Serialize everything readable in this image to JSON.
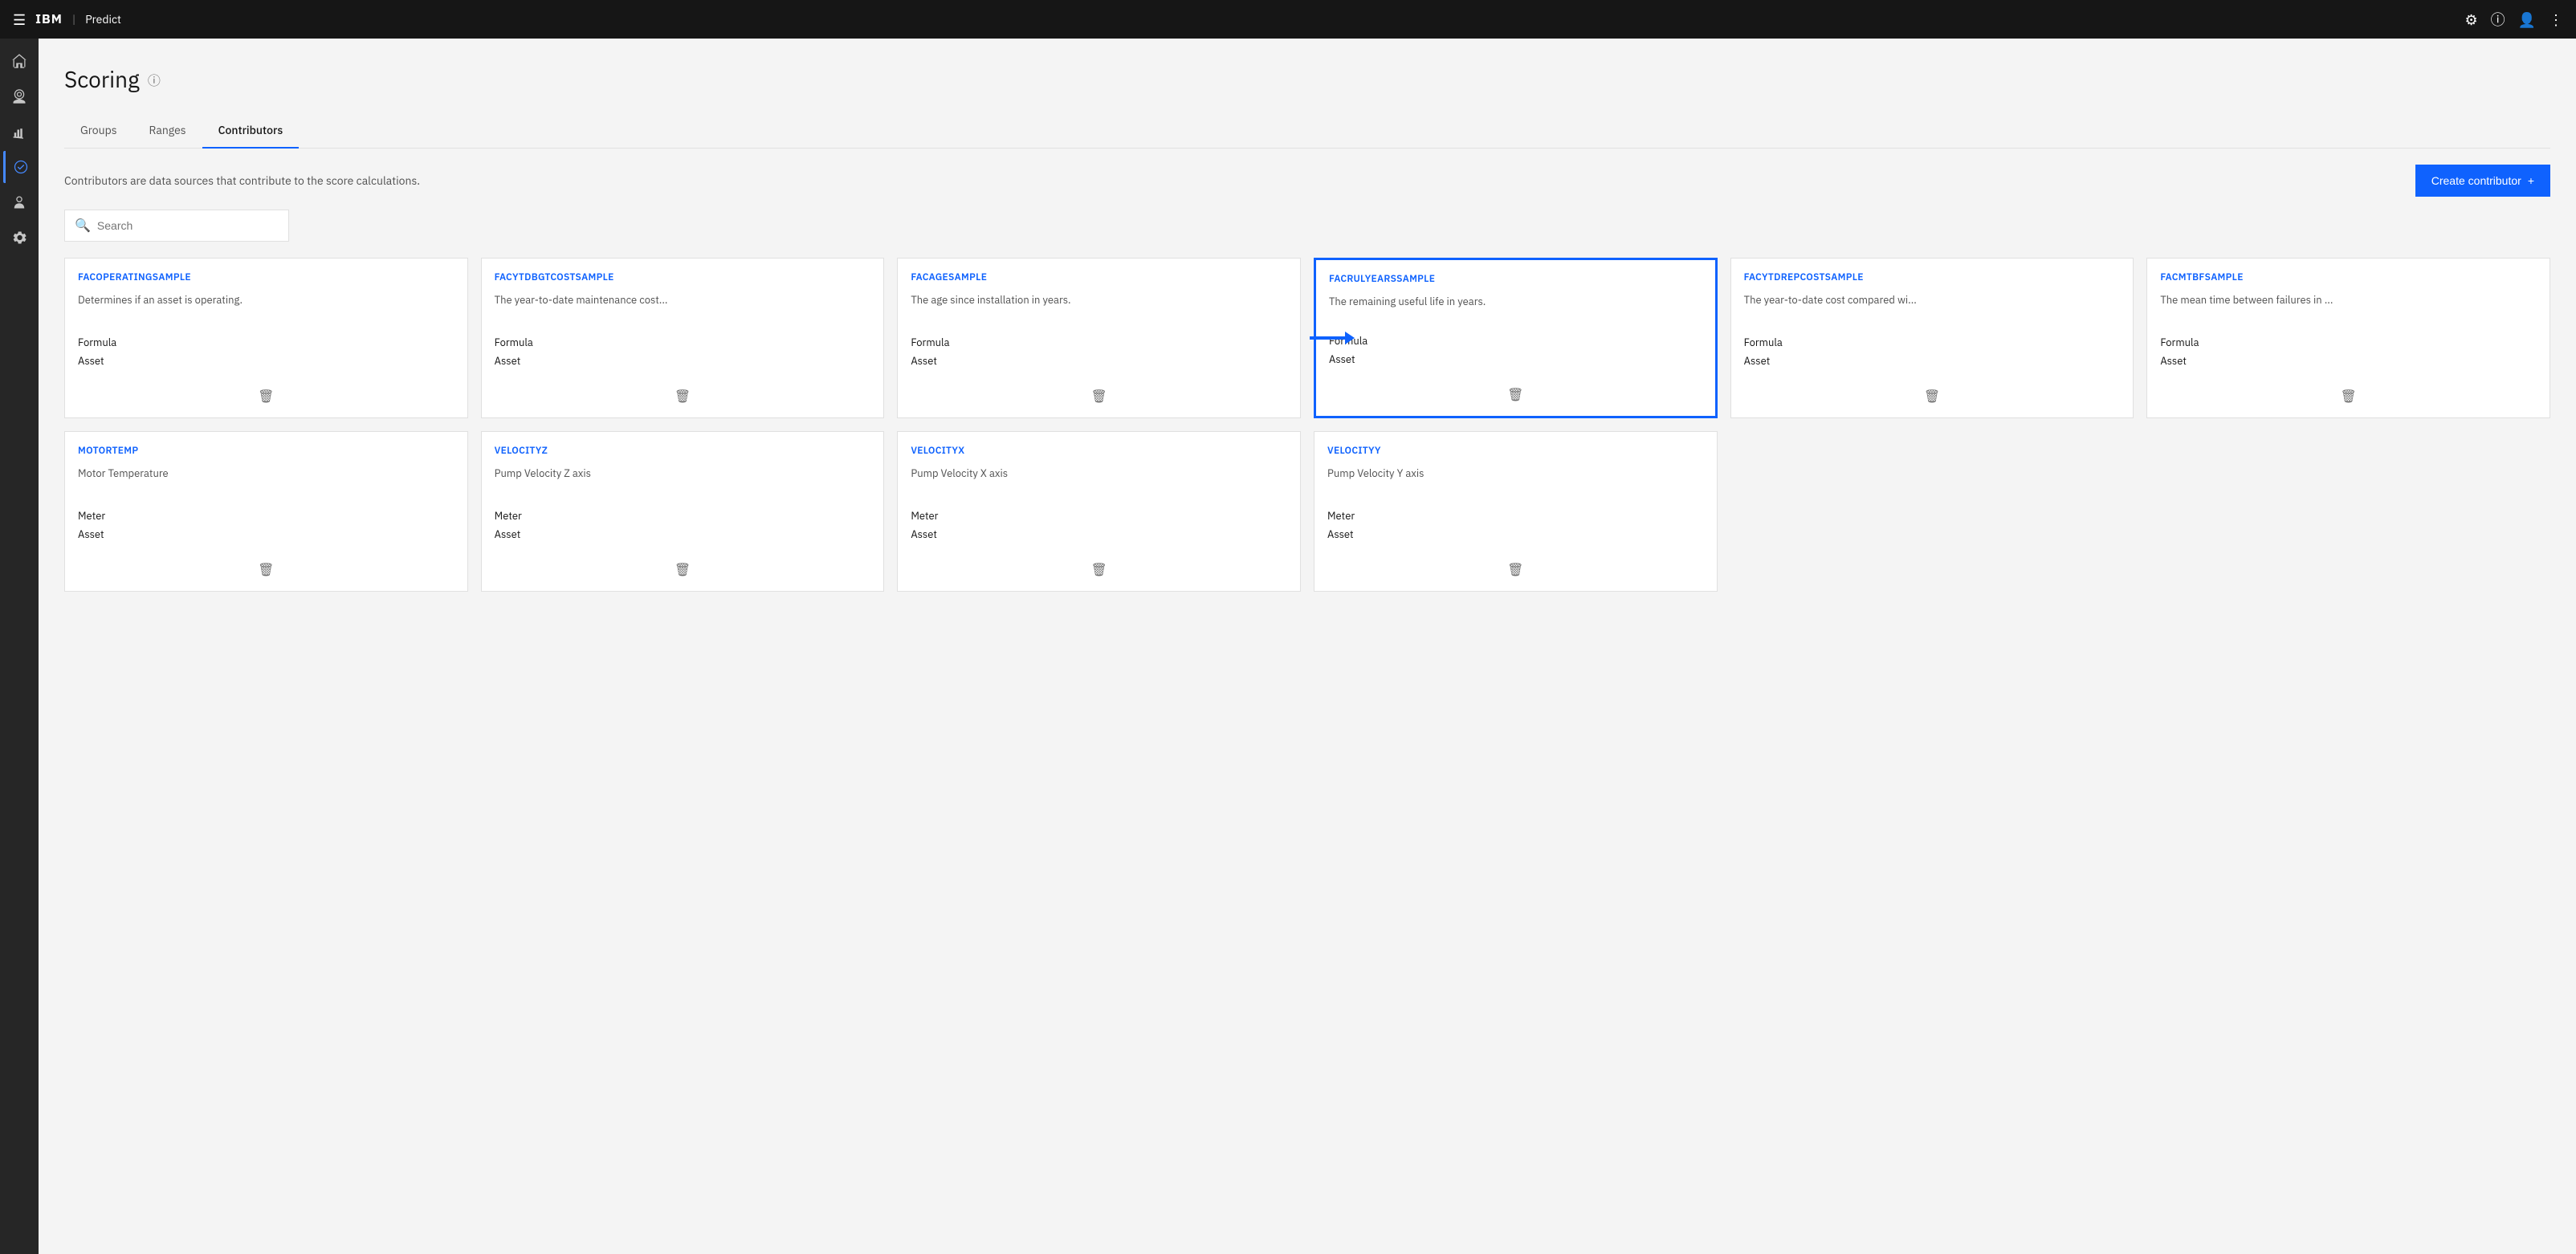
{
  "topNav": {
    "ibm": "IBM",
    "divider": "|",
    "appName": "Predict"
  },
  "pageTitle": "Scoring",
  "tabs": [
    {
      "id": "groups",
      "label": "Groups"
    },
    {
      "id": "ranges",
      "label": "Ranges"
    },
    {
      "id": "contributors",
      "label": "Contributors",
      "active": true
    }
  ],
  "description": "Contributors are data sources that contribute to the score calculations.",
  "createButton": "Create contributor",
  "search": {
    "placeholder": "Search",
    "value": ""
  },
  "row1Cards": [
    {
      "id": "facoperatingsample",
      "title": "FACOPERATINGSAMPLE",
      "description": "Determines if an asset is operating.",
      "field1": "Formula",
      "field2": "Asset",
      "highlighted": false,
      "hasArrow": false
    },
    {
      "id": "facytdbgtcostsample",
      "title": "FACYTDBGTCOSTSAMPLE",
      "description": "The year-to-date maintenance cost...",
      "field1": "Formula",
      "field2": "Asset",
      "highlighted": false,
      "hasArrow": false
    },
    {
      "id": "facagesample",
      "title": "FACAGESAMPLE",
      "description": "The age since installation in years.",
      "field1": "Formula",
      "field2": "Asset",
      "highlighted": false,
      "hasArrow": true
    },
    {
      "id": "facrulyearssample",
      "title": "FACRULYEARSSAMPLE",
      "description": "The remaining useful life in years.",
      "field1": "Formula",
      "field2": "Asset",
      "highlighted": true,
      "hasArrow": false
    },
    {
      "id": "facytdrepcostsample",
      "title": "FACYTDREPCOSTSAMPLE",
      "description": "The year-to-date cost compared wi...",
      "field1": "Formula",
      "field2": "Asset",
      "highlighted": false,
      "hasArrow": false
    },
    {
      "id": "facmtbfsample",
      "title": "FACMTBFSAMPLE",
      "description": "The mean time between failures in ...",
      "field1": "Formula",
      "field2": "Asset",
      "highlighted": false,
      "hasArrow": false
    }
  ],
  "row2Cards": [
    {
      "id": "motortemp",
      "title": "MOTORTEMP",
      "description": "Motor Temperature",
      "field1": "Meter",
      "field2": "Asset"
    },
    {
      "id": "velocityz",
      "title": "VELOCITYZ",
      "description": "Pump Velocity Z axis",
      "field1": "Meter",
      "field2": "Asset"
    },
    {
      "id": "velocityx",
      "title": "VELOCITYX",
      "description": "Pump Velocity X axis",
      "field1": "Meter",
      "field2": "Asset"
    },
    {
      "id": "velocityy",
      "title": "VELOCITYY",
      "description": "Pump Velocity Y axis",
      "field1": "Meter",
      "field2": "Asset"
    }
  ]
}
